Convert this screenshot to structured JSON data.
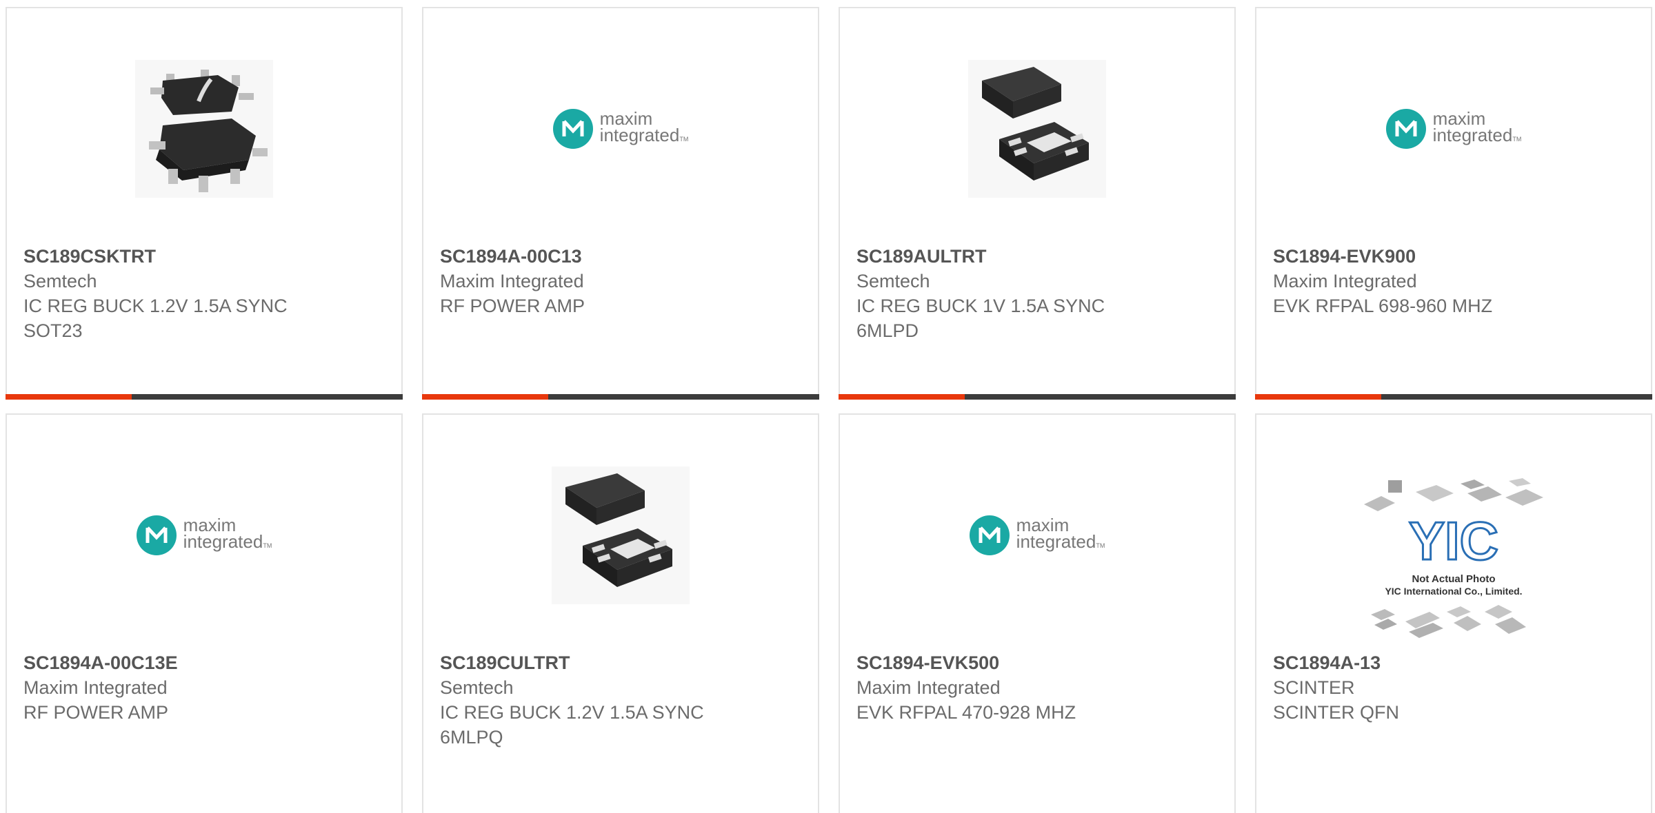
{
  "products": [
    {
      "part": "SC189CSKTRT",
      "manufacturer": "Semtech",
      "description": "IC REG BUCK 1.2V 1.5A SYNC SOT23",
      "image": "sot23-chip-icon"
    },
    {
      "part": "SC1894A-00C13",
      "manufacturer": "Maxim Integrated",
      "description": "RF POWER AMP",
      "image": "maxim-logo"
    },
    {
      "part": "SC189AULTRT",
      "manufacturer": "Semtech",
      "description": "IC REG BUCK 1V 1.5A SYNC 6MLPD",
      "image": "mlp-chip-icon"
    },
    {
      "part": "SC1894-EVK900",
      "manufacturer": "Maxim Integrated",
      "description": "EVK RFPAL 698-960 MHZ",
      "image": "maxim-logo"
    },
    {
      "part": "SC1894A-00C13E",
      "manufacturer": "Maxim Integrated",
      "description": "RF POWER AMP",
      "image": "maxim-logo"
    },
    {
      "part": "SC189CULTRT",
      "manufacturer": "Semtech",
      "description": "IC REG BUCK 1.2V 1.5A SYNC 6MLPQ",
      "image": "mlp-chip-icon"
    },
    {
      "part": "SC1894-EVK500",
      "manufacturer": "Maxim Integrated",
      "description": "EVK RFPAL 470-928 MHZ",
      "image": "maxim-logo"
    },
    {
      "part": "SC1894A-13",
      "manufacturer": "SCINTER",
      "description": "SCINTER QFN",
      "image": "yic-placeholder"
    }
  ],
  "maxim_logo": {
    "line1": "maxim",
    "line2": "integrated",
    "tm": "TM"
  },
  "yic_placeholder": {
    "mark": "YIC",
    "line1": "Not Actual Photo",
    "line2": "YIC International Co., Limited."
  },
  "colors": {
    "accent": "#e8380d",
    "bar": "#3c3c3c",
    "maxim": "#1aa9a4",
    "yic": "#2a6fb5"
  }
}
